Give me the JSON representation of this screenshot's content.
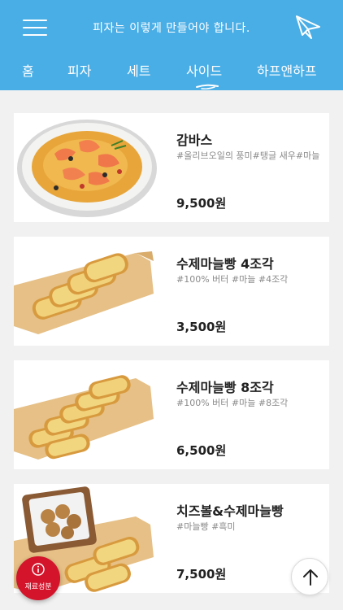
{
  "header": {
    "title": "피자는 이렇게 만들어야 합니다.",
    "menu_icon": "hamburger-menu-icon",
    "plane_icon": "paper-plane-icon",
    "background_color": "#4aaee6"
  },
  "tabs": [
    {
      "label": "홈"
    },
    {
      "label": "피자"
    },
    {
      "label": "세트"
    },
    {
      "label": "사이드",
      "active": true
    },
    {
      "label": "하프앤하프"
    }
  ],
  "items": [
    {
      "name": "감바스",
      "tags": "#올리브오일의 풍미#탱글 새우#마늘",
      "price": "9,500원"
    },
    {
      "name": "수제마늘빵 4조각",
      "tags": "#100% 버터 #마늘 #4조각",
      "price": "3,500원"
    },
    {
      "name": "수제마늘빵 8조각",
      "tags": "#100% 버터 #마늘 #8조각",
      "price": "6,500원"
    },
    {
      "name": "치즈볼&수제마늘빵",
      "tags": "#마늘빵 #흑미",
      "price": "7,500원"
    }
  ],
  "ingredients_button": {
    "label": "재료성분",
    "icon": "info-icon",
    "color": "#d3142b"
  },
  "scroll_top_button": {
    "icon": "arrow-up-icon"
  }
}
